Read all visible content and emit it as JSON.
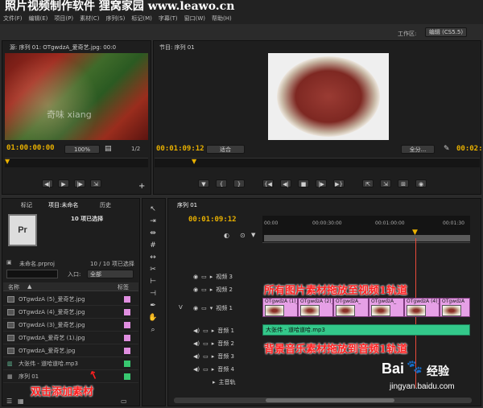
{
  "watermark": "照片视频制作软件 狸窝家园 www.leawo.cn",
  "menu": [
    "文件(F)",
    "编辑(E)",
    "项目(P)",
    "素材(C)",
    "序列(S)",
    "标记(M)",
    "字幕(T)",
    "窗口(W)",
    "帮助(H)"
  ],
  "workspace": {
    "label": "工作区:",
    "value": "编辑 (CS5.5)"
  },
  "source_monitor": {
    "tab": "源: 序列 01: OTgwdzA_爱奇艺.jpg: 00:0",
    "timecode": "01:00:00:00",
    "zoom": "100%",
    "page": "1/2",
    "frame_watermark": "奇味 xiang"
  },
  "program_monitor": {
    "tab": "节目: 序列 01",
    "timecode": "00:01:09:12",
    "fit": "适合",
    "full": "全分...",
    "duration": "00:02:"
  },
  "project_panel": {
    "tabs": [
      "标记",
      "项目:未命名",
      "历史"
    ],
    "selected_count": "10 项已选择",
    "project_file": "未命名.prproj",
    "count_of": "10 / 10 项已选择",
    "search_placeholder": "",
    "in_label": "入口:",
    "in_value": "全部",
    "col_name": "名称",
    "col_label": "标签",
    "items": [
      {
        "name": "OTgwdzA (5)_爱奇艺.jpg",
        "kind": "image",
        "color": "#e08ee0"
      },
      {
        "name": "OTgwdzA (4)_爱奇艺.jpg",
        "kind": "image",
        "color": "#e08ee0"
      },
      {
        "name": "OTgwdzA (3)_爱奇艺.jpg",
        "kind": "image",
        "color": "#e08ee0"
      },
      {
        "name": "OTgwdzA_爱奇艺 (1).jpg",
        "kind": "image",
        "color": "#e08ee0"
      },
      {
        "name": "OTgwdzA_爱奇艺.jpg",
        "kind": "image",
        "color": "#e08ee0"
      },
      {
        "name": "大张伟 - 道哈道哈.mp3",
        "kind": "audio",
        "color": "#38c870"
      },
      {
        "name": "序列 01",
        "kind": "sequence",
        "color": "#38c870"
      }
    ],
    "annotation": "双击添加素材"
  },
  "timeline": {
    "tab": "序列 01",
    "timecode": "00:01:09:12",
    "ruler": [
      "00:00",
      "00:00:30:00",
      "00:01:00:00",
      "00:01:30"
    ],
    "video_tracks": [
      "视频 3",
      "视频 2",
      "视频 1"
    ],
    "audio_tracks": [
      "音频 1",
      "音频 2",
      "音频 3",
      "音频 4",
      "主音轨"
    ],
    "video_clips": [
      "OTgwdzA (1)_",
      "OTgwdzA (2)_",
      "OTgwdzA_",
      "OTgwdzA_",
      "OTgwdzA (4)_",
      "OTgwdzA"
    ],
    "audio_clip": "大张伟 - 道哈道哈.mp3",
    "annotation_video": "所有图片素材拖放至视频1轨道",
    "annotation_audio": "背景音乐素材拖放到音频1轨道"
  },
  "baidu": {
    "logo": "Bai",
    "logo2": "经验",
    "url": "jingyan.baidu.com"
  }
}
